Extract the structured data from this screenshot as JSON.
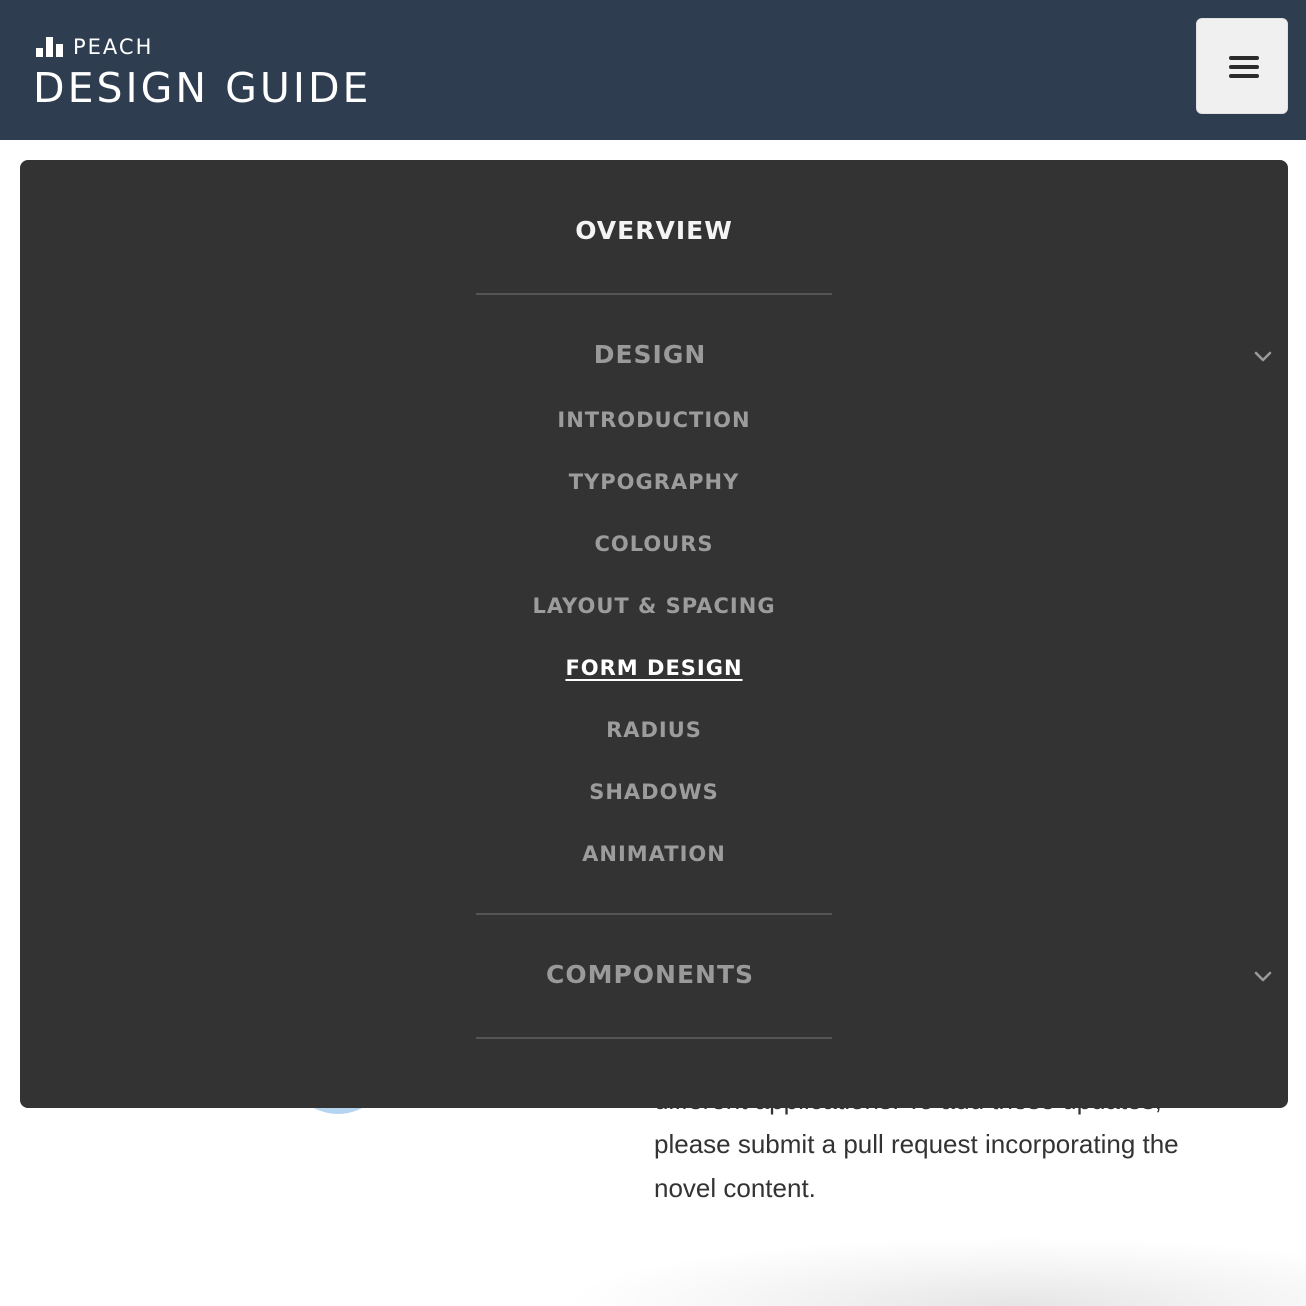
{
  "header": {
    "brand": "PEACH",
    "title": "DESIGN GUIDE",
    "menu_button_icon": "hamburger-icon",
    "background_color": "#2e3d50"
  },
  "menu": {
    "overview_label": "OVERVIEW",
    "design_heading": "DESIGN",
    "design_items": [
      "INTRODUCTION",
      "TYPOGRAPHY",
      "COLOURS",
      "LAYOUT & SPACING",
      "FORM DESIGN",
      "RADIUS",
      "SHADOWS",
      "ANIMATION"
    ],
    "active_item": "FORM DESIGN",
    "components_heading": "COMPONENTS",
    "expand_icon": "chevron-down-icon",
    "background_color": "#333333"
  },
  "page": {
    "body_lines": [
      "different applications. To add these updates,",
      "please submit a pull request incorporating the",
      "novel content."
    ]
  }
}
